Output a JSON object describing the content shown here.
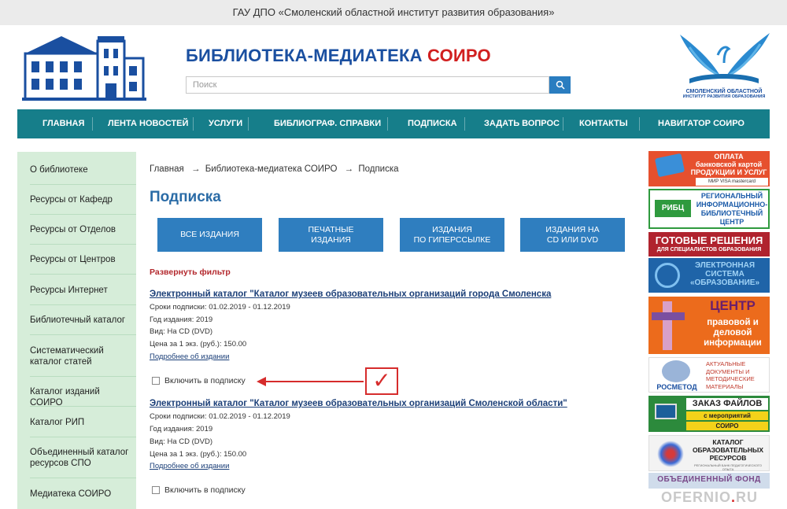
{
  "topbar": {
    "text": "ГАУ ДПО «Смоленский областной институт развития образования»"
  },
  "header": {
    "title_main": "БИБЛИОТЕКА-МЕДИАТЕКА ",
    "title_accent": "СОИРО",
    "search_placeholder": "Поиск",
    "right_logo_line1": "СМОЛЕНСКИЙ ОБЛАСТНОЙ",
    "right_logo_line2": "ИНСТИТУТ РАЗВИТИЯ ОБРАЗОВАНИЯ"
  },
  "nav": {
    "items": [
      "ГЛАВНАЯ",
      "ЛЕНТА НОВОСТЕЙ",
      "УСЛУГИ",
      "БИБЛИОГРАФ. СПРАВКИ",
      "ПОДПИСКА",
      "ЗАДАТЬ ВОПРОС",
      "КОНТАКТЫ",
      "НАВИГАТОР СОИРО"
    ]
  },
  "sidebar": {
    "items": [
      "О библиотеке",
      "Ресурсы от Кафедр",
      "Ресурсы от Отделов",
      "Ресурсы от Центров",
      "Ресурсы Интернет",
      "Библиотечный каталог",
      "Систематический каталог статей",
      "Каталог изданий СОИРО",
      "Каталог РИП",
      "Объединенный каталог ресурсов СПО",
      "Медиатека СОИРО"
    ]
  },
  "breadcrumb": {
    "home": "Главная",
    "sep": "→",
    "section": "Библиотека-медиатека СОИРО",
    "current": "Подписка"
  },
  "page_title": "Подписка",
  "filters": [
    {
      "line1": "ВСЕ ИЗДАНИЯ",
      "line2": ""
    },
    {
      "line1": "ПЕЧАТНЫЕ",
      "line2": "ИЗДАНИЯ"
    },
    {
      "line1": "ИЗДАНИЯ",
      "line2": "ПО ГИПЕРССЫЛКЕ"
    },
    {
      "line1": "ИЗДАНИЯ НА",
      "line2": "CD ИЛИ DVD"
    }
  ],
  "expand_filter": "Развернуть фильтр",
  "items": [
    {
      "title": "Электронный каталог \"Каталог музеев образовательных организаций города Смоленска",
      "period": "Сроки подписки: 01.02.2019 - 01.12.2019",
      "year": "Год издания:  2019",
      "type": "Вид:  На CD (DVD)",
      "price": "Цена за 1 экз. (руб.): 150.00",
      "more": "Подробнее об издании",
      "subscribe": "Включить в подписку"
    },
    {
      "title": "Электронный каталог \"Каталог музеев образовательных организаций Смоленской области\"",
      "period": "Сроки подписки: 01.02.2019 - 01.12.2019",
      "year": "Год издания:  2019",
      "type": "Вид:  На CD (DVD)",
      "price": "Цена за 1 экз. (руб.): 150.00",
      "more": "Подробнее об издании",
      "subscribe": "Включить в подписку"
    }
  ],
  "annotation": {
    "check": "✓"
  },
  "banners": {
    "b1": {
      "l1": "ОПЛАТА",
      "l2": "банковской картой",
      "l3": "ПРОДУКЦИИ И УСЛУГ",
      "l4": "МИР  VISA  mastercard"
    },
    "b2": {
      "l1": "РЕГИОНАЛЬНЫЙ",
      "l2": "ИНФОРМАЦИОННО-",
      "l3": "БИБЛИОТЕЧНЫЙ",
      "l4": "ЦЕНТР",
      "logo": "РИБЦ"
    },
    "b3": {
      "l1": "ГОТОВЫЕ РЕШЕНИЯ",
      "l2": "ДЛЯ СПЕЦИАЛИСТОВ ОБРАЗОВАНИЯ"
    },
    "b4": {
      "l1": "ЭЛЕКТРОННАЯ",
      "l2": "СИСТЕМА",
      "l3": "«ОБРАЗОВАНИЕ»"
    },
    "b5": {
      "l1": "ЦЕНТР",
      "l2": "правовой и",
      "l3": "деловой",
      "l4": "информации"
    },
    "b6": {
      "l1": "АКТУАЛЬНЫЕ",
      "l2": "ДОКУМЕНТЫ И",
      "l3": "МЕТОДИЧЕСКИЕ",
      "l4": "МАТЕРИАЛЫ",
      "logo": "РОСМЕТОД"
    },
    "b7": {
      "l1": "ЗАКАЗ ФАЙЛОВ",
      "l2": "с мероприятий",
      "l3": "СОИРО"
    },
    "b8": {
      "l1": "КАТАЛОГ",
      "l2": "ОБРАЗОВАТЕЛЬНЫХ",
      "l3": "РЕСУРСОВ",
      "l4": "РЕГИОНАЛЬНЫЙ БАНК ПЕДАГОГИЧЕСКОГО ОПЫТА"
    },
    "b9": {
      "l1": "ОБЪЕДИНЕННЫЙ ФОНД"
    }
  },
  "watermark": {
    "a": "OFERNIO",
    "dot": ".",
    "b": "RU"
  }
}
